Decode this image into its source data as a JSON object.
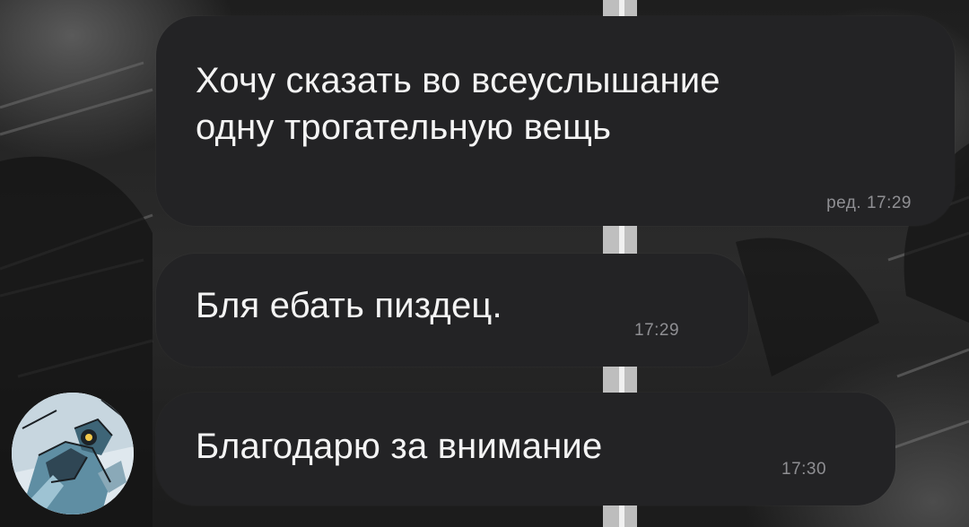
{
  "chat": {
    "messages": [
      {
        "text_lines": [
          "Хочу сказать во всеуслышание",
          "одну трогательную вещь"
        ],
        "meta": "ред. 17:29",
        "edited": true
      },
      {
        "text": "Бля ебать пиздец.",
        "meta": "17:29"
      },
      {
        "text": "Благодарю за внимание",
        "meta": "17:30"
      }
    ],
    "sender_avatar": "robot-character-avatar-icon"
  },
  "colors": {
    "bubble_bg": "#232325",
    "message_text": "#f4f4f4",
    "timestamp_text": "#8f8f93",
    "wallpaper_dark": "#1e1e1e"
  }
}
